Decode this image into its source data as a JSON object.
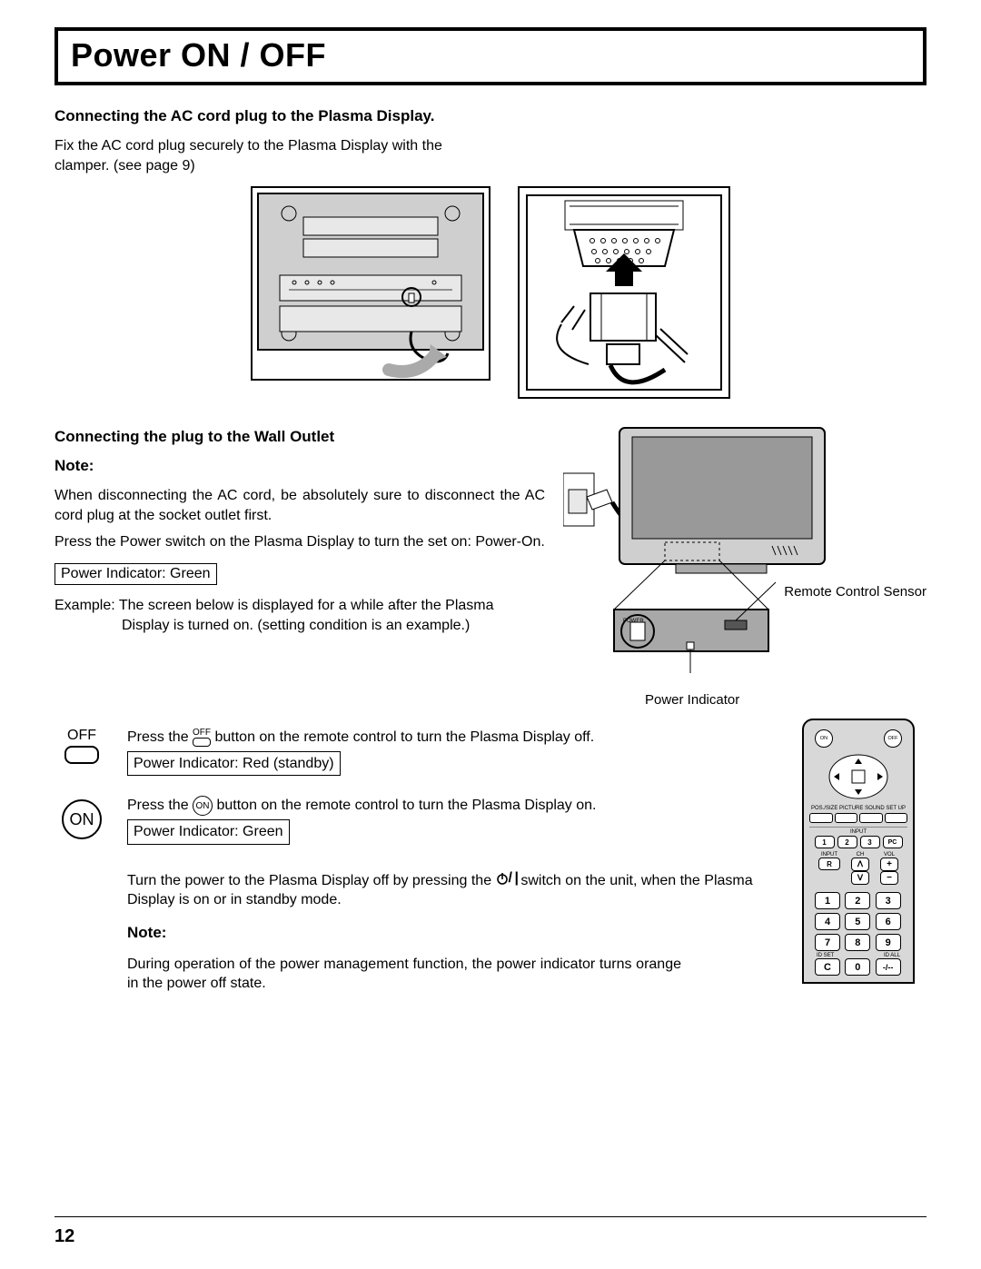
{
  "title": "Power ON / OFF",
  "section1": {
    "heading": "Connecting the AC cord plug to the Plasma Display.",
    "body": "Fix the AC cord plug securely to the Plasma Display with the clamper. (see page 9)"
  },
  "section2": {
    "heading": "Connecting the plug to the Wall Outlet",
    "note_label": "Note:",
    "note_body": "When disconnecting the AC cord, be absolutely sure to disconnect the AC cord plug at the socket outlet first.",
    "press_text": "Press the Power switch on the Plasma Display to turn the set on: Power-On.",
    "indicator_green": "Power Indicator: Green",
    "example_prefix": "Example: ",
    "example_body": "The screen below is displayed for a while after the Plasma Display is turned on. (setting condition is an example.)"
  },
  "tv_labels": {
    "remote_sensor": "Remote Control Sensor",
    "power_indicator": "Power Indicator"
  },
  "off_row": {
    "icon_label": "OFF",
    "press_prefix": "Press the ",
    "icon_inline": "OFF",
    "press_suffix": " button on the remote control to turn the Plasma Display off.",
    "indicator": "Power Indicator: Red (standby)"
  },
  "on_row": {
    "icon_label": "ON",
    "press_prefix": "Press the ",
    "icon_inline": "ON",
    "press_suffix": " button on the remote control to turn the Plasma Display on.",
    "indicator": "Power Indicator: Green"
  },
  "turn_off_text_prefix": "Turn the power to the Plasma Display off by pressing the ",
  "turn_off_text_suffix": " switch on the unit, when the Plasma Display is on or in standby mode.",
  "note2_label": "Note:",
  "note2_body": "During operation of the power management function, the power indicator turns orange in the power off state.",
  "remote": {
    "on": "ON",
    "off": "OFF",
    "labels": [
      "POS./SIZE",
      "PICTURE",
      "SOUND",
      "SET UP"
    ],
    "input": "INPUT",
    "pc": "PC",
    "ch": "CH",
    "vol": "VOL",
    "r": "R",
    "plus": "+",
    "minus": "−",
    "up": "ᐱ",
    "down": "ᐯ",
    "numbers": [
      "1",
      "2",
      "3",
      "4",
      "5",
      "6",
      "7",
      "8",
      "9",
      "C",
      "0",
      "-/--"
    ],
    "input_nums": [
      "1",
      "2",
      "3"
    ],
    "idset": "ID SET",
    "idall": "ID ALL"
  },
  "page_number": "12"
}
